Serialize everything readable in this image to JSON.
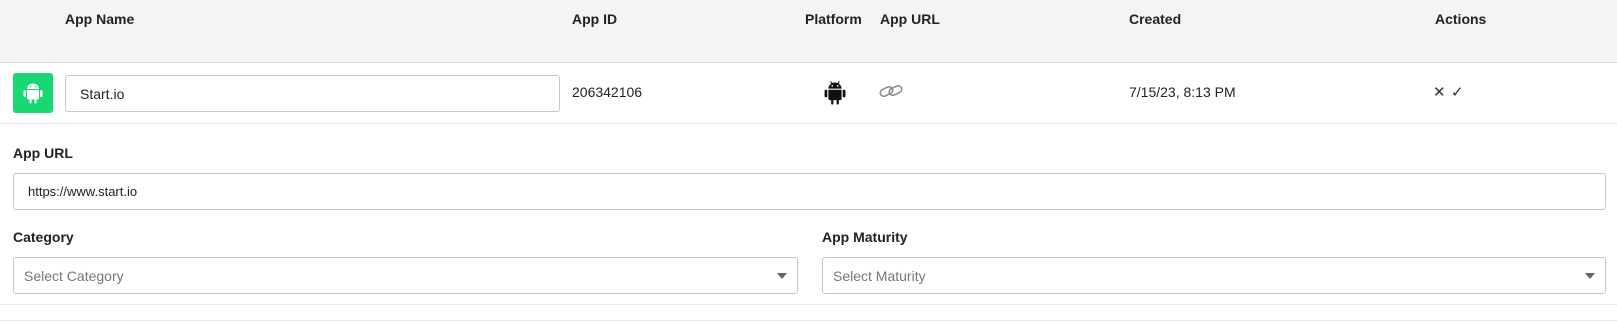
{
  "table": {
    "headers": {
      "app_name": "App Name",
      "app_id": "App ID",
      "platform": "Platform",
      "app_url": "App URL",
      "created": "Created",
      "actions": "Actions"
    },
    "row": {
      "app_name_value": "Start.io",
      "app_id": "206342106",
      "platform_icon": "android-icon",
      "app_url_icon": "link-icon",
      "created": "7/15/23, 8:13 PM",
      "actions": {
        "cancel_icon": "close-icon",
        "confirm_icon": "check-icon"
      }
    }
  },
  "details": {
    "app_url_label": "App URL",
    "app_url_value": "https://www.start.io",
    "category_label": "Category",
    "category_placeholder": "Select Category",
    "maturity_label": "App Maturity",
    "maturity_placeholder": "Select Maturity"
  },
  "colors": {
    "android_green": "#17d872",
    "header_bg": "#f4f4f4"
  }
}
